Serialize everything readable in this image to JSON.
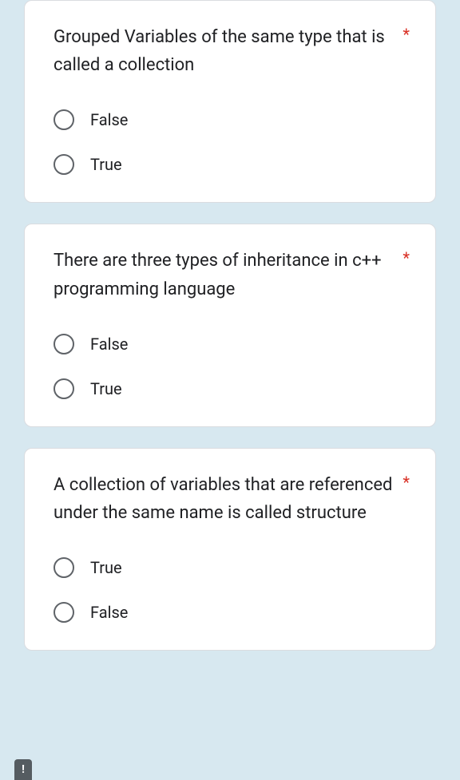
{
  "questions": [
    {
      "text": "Grouped Variables of the same type that is called a collection",
      "required": true,
      "options": [
        "False",
        "True"
      ]
    },
    {
      "text": "There are three types of inheritance in c++ programming language",
      "required": true,
      "options": [
        "False",
        "True"
      ]
    },
    {
      "text": "A collection of variables that are referenced under the same name is called structure",
      "required": true,
      "options": [
        "True",
        "False"
      ]
    }
  ],
  "required_marker": "*",
  "error_icon": "!"
}
